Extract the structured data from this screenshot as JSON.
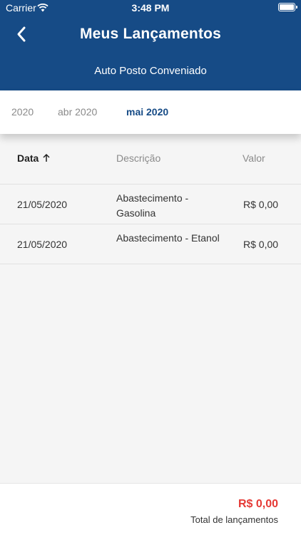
{
  "status_bar": {
    "carrier": "Carrier",
    "time": "3:48 PM"
  },
  "header": {
    "title": "Meus Lançamentos",
    "subtitle": "Auto Posto Conveniado",
    "back_icon": "chevron-left-icon"
  },
  "period_tabs": [
    {
      "label": "2020",
      "active": false
    },
    {
      "label": "abr 2020",
      "active": false
    },
    {
      "label": "mai 2020",
      "active": true
    }
  ],
  "table": {
    "columns": {
      "date": "Data",
      "description": "Descrição",
      "value": "Valor"
    },
    "sort_icon": "arrow-up-icon",
    "rows": [
      {
        "date": "21/05/2020",
        "description": "Abastecimento - Gasolina",
        "value": "R$ 0,00"
      },
      {
        "date": "21/05/2020",
        "description": "Abastecimento - Etanol",
        "value": "R$ 0,00"
      }
    ]
  },
  "footer": {
    "total_value": "R$ 0,00",
    "total_label": "Total de lançamentos"
  },
  "colors": {
    "header_bg": "#164b86",
    "active_tab": "#164b86",
    "total_value": "#e53935"
  }
}
